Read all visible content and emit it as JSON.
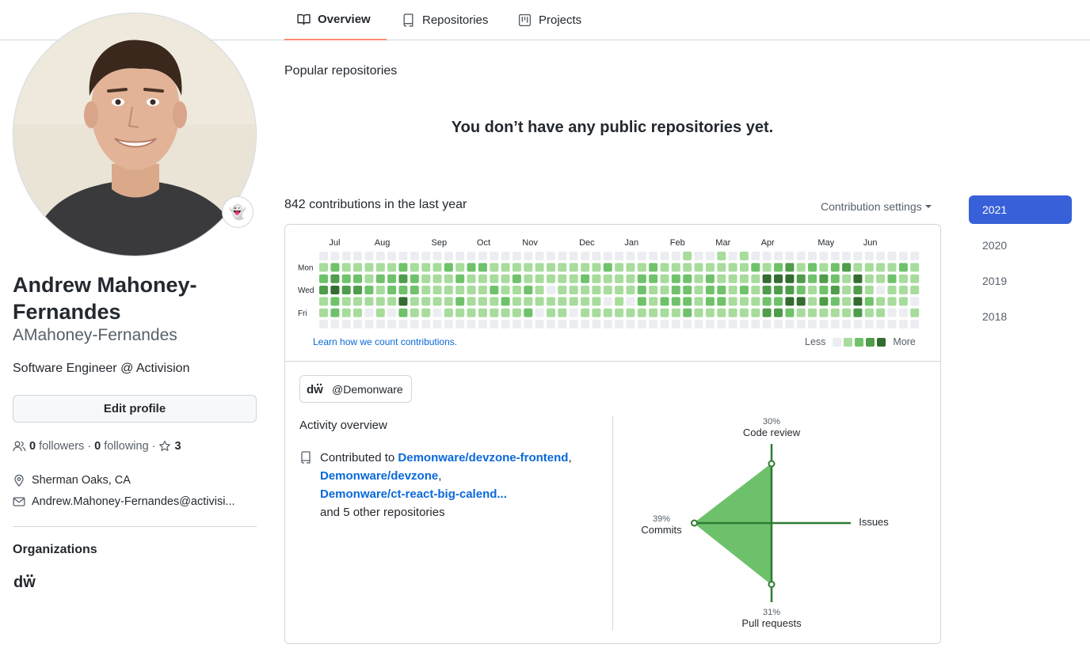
{
  "tabs": [
    {
      "label": "Overview",
      "icon": "book-icon",
      "selected": true
    },
    {
      "label": "Repositories",
      "icon": "repo-icon",
      "selected": false
    },
    {
      "label": "Projects",
      "icon": "project-icon",
      "selected": false
    }
  ],
  "profile": {
    "name": "Andrew Mahoney-Fernandes",
    "login": "AMahoney-Fernandes",
    "bio": "Software Engineer @ Activision",
    "edit_label": "Edit profile",
    "status_emoji": "👻",
    "followers_count": "0",
    "followers_label": "followers",
    "following_count": "0",
    "following_label": "following",
    "stars_count": "3",
    "location": "Sherman Oaks, CA",
    "email": "Andrew.Mahoney-Fernandes@activisi..."
  },
  "organizations": {
    "heading": "Organizations",
    "logo_text": "dw"
  },
  "popular": {
    "heading": "Popular repositories",
    "empty_message": "You don’t have any public repositories yet."
  },
  "contributions": {
    "heading": "842 contributions in the last year",
    "settings_label": "Contribution settings",
    "months": [
      "Jul",
      "Aug",
      "Sep",
      "Oct",
      "Nov",
      "Dec",
      "Jan",
      "Feb",
      "Mar",
      "Apr",
      "May",
      "Jun"
    ],
    "day_labels": [
      "Mon",
      "Wed",
      "Fri"
    ],
    "learn_link": "Learn how we count contributions.",
    "legend_less": "Less",
    "legend_more": "More",
    "colors": [
      "#ebedf0",
      "#9be9a8",
      "#40c463",
      "#30a14e",
      "#216e39"
    ],
    "grid_colors": [
      "#ebedf0",
      "#a7dc9c",
      "#6fc26a",
      "#4f9c4a",
      "#346b30"
    ],
    "weeks": [
      [
        0,
        1,
        2,
        3,
        1,
        1,
        0
      ],
      [
        0,
        2,
        3,
        4,
        2,
        2,
        0
      ],
      [
        0,
        1,
        2,
        3,
        1,
        1,
        0
      ],
      [
        0,
        1,
        2,
        3,
        1,
        1,
        0
      ],
      [
        0,
        1,
        1,
        2,
        1,
        0,
        0
      ],
      [
        0,
        1,
        2,
        1,
        1,
        1,
        0
      ],
      [
        0,
        1,
        2,
        2,
        1,
        0,
        0
      ],
      [
        0,
        2,
        3,
        2,
        4,
        2,
        0
      ],
      [
        0,
        1,
        2,
        2,
        1,
        1,
        0
      ],
      [
        0,
        1,
        1,
        1,
        1,
        1,
        0
      ],
      [
        0,
        1,
        1,
        1,
        1,
        0,
        0
      ],
      [
        0,
        2,
        1,
        1,
        1,
        1,
        0
      ],
      [
        0,
        1,
        2,
        1,
        2,
        1,
        0
      ],
      [
        0,
        2,
        1,
        1,
        1,
        1,
        0
      ],
      [
        0,
        2,
        1,
        1,
        1,
        1,
        0
      ],
      [
        0,
        1,
        1,
        2,
        1,
        1,
        0
      ],
      [
        0,
        1,
        1,
        1,
        2,
        1,
        0
      ],
      [
        0,
        1,
        2,
        1,
        1,
        1,
        0
      ],
      [
        0,
        1,
        1,
        2,
        1,
        2,
        0
      ],
      [
        0,
        1,
        1,
        1,
        1,
        0,
        0
      ],
      [
        0,
        1,
        1,
        0,
        1,
        1,
        0
      ],
      [
        0,
        1,
        1,
        1,
        1,
        1,
        0
      ],
      [
        0,
        1,
        1,
        1,
        1,
        0,
        0
      ],
      [
        0,
        1,
        2,
        1,
        1,
        1,
        0
      ],
      [
        0,
        1,
        1,
        1,
        1,
        1,
        0
      ],
      [
        0,
        2,
        1,
        1,
        0,
        1,
        0
      ],
      [
        0,
        1,
        1,
        1,
        1,
        1,
        0
      ],
      [
        0,
        1,
        1,
        1,
        0,
        1,
        0
      ],
      [
        0,
        1,
        2,
        2,
        2,
        1,
        0
      ],
      [
        0,
        2,
        2,
        1,
        1,
        1,
        0
      ],
      [
        0,
        1,
        1,
        1,
        2,
        1,
        0
      ],
      [
        0,
        1,
        2,
        2,
        2,
        1,
        0
      ],
      [
        1,
        1,
        2,
        2,
        2,
        2,
        0
      ],
      [
        0,
        1,
        1,
        1,
        1,
        1,
        0
      ],
      [
        0,
        1,
        2,
        2,
        2,
        1,
        0
      ],
      [
        1,
        1,
        1,
        2,
        2,
        1,
        0
      ],
      [
        0,
        1,
        1,
        1,
        1,
        1,
        0
      ],
      [
        1,
        1,
        1,
        2,
        1,
        1,
        0
      ],
      [
        0,
        2,
        1,
        1,
        1,
        1,
        0
      ],
      [
        0,
        1,
        4,
        3,
        2,
        3,
        0
      ],
      [
        0,
        2,
        4,
        3,
        2,
        3,
        0
      ],
      [
        0,
        3,
        4,
        3,
        4,
        2,
        0
      ],
      [
        0,
        1,
        3,
        2,
        4,
        1,
        0
      ],
      [
        0,
        2,
        2,
        1,
        1,
        1,
        0
      ],
      [
        0,
        1,
        3,
        2,
        3,
        1,
        0
      ],
      [
        0,
        2,
        2,
        3,
        2,
        1,
        0
      ],
      [
        0,
        3,
        1,
        1,
        1,
        1,
        0
      ],
      [
        0,
        1,
        4,
        3,
        4,
        3,
        0
      ],
      [
        0,
        1,
        1,
        1,
        2,
        1,
        0
      ],
      [
        0,
        1,
        1,
        0,
        1,
        1,
        0
      ],
      [
        0,
        1,
        2,
        1,
        1,
        0,
        0
      ],
      [
        0,
        2,
        1,
        1,
        1,
        0,
        0
      ],
      [
        0,
        1,
        1,
        1,
        0,
        1,
        0
      ]
    ]
  },
  "activity": {
    "org_chip": "@Demonware",
    "org_chip_logo": "dw",
    "heading": "Activity overview",
    "contributed_prefix": "Contributed to",
    "repos": [
      "Demonware/devzone-frontend",
      "Demonware/devzone",
      "Demonware/ct-react-big-calend..."
    ],
    "suffix": "and 5 other repositories",
    "radar": {
      "code_review_pct": "30%",
      "code_review_label": "Code review",
      "commits_pct": "39%",
      "commits_label": "Commits",
      "pull_requests_pct": "31%",
      "pull_requests_label": "Pull requests",
      "issues_label": "Issues",
      "values": {
        "code_review": 30,
        "commits": 39,
        "pull_requests": 31,
        "issues": 0
      }
    }
  },
  "years": [
    {
      "label": "2021",
      "selected": true
    },
    {
      "label": "2020",
      "selected": false
    },
    {
      "label": "2019",
      "selected": false
    },
    {
      "label": "2018",
      "selected": false
    }
  ]
}
